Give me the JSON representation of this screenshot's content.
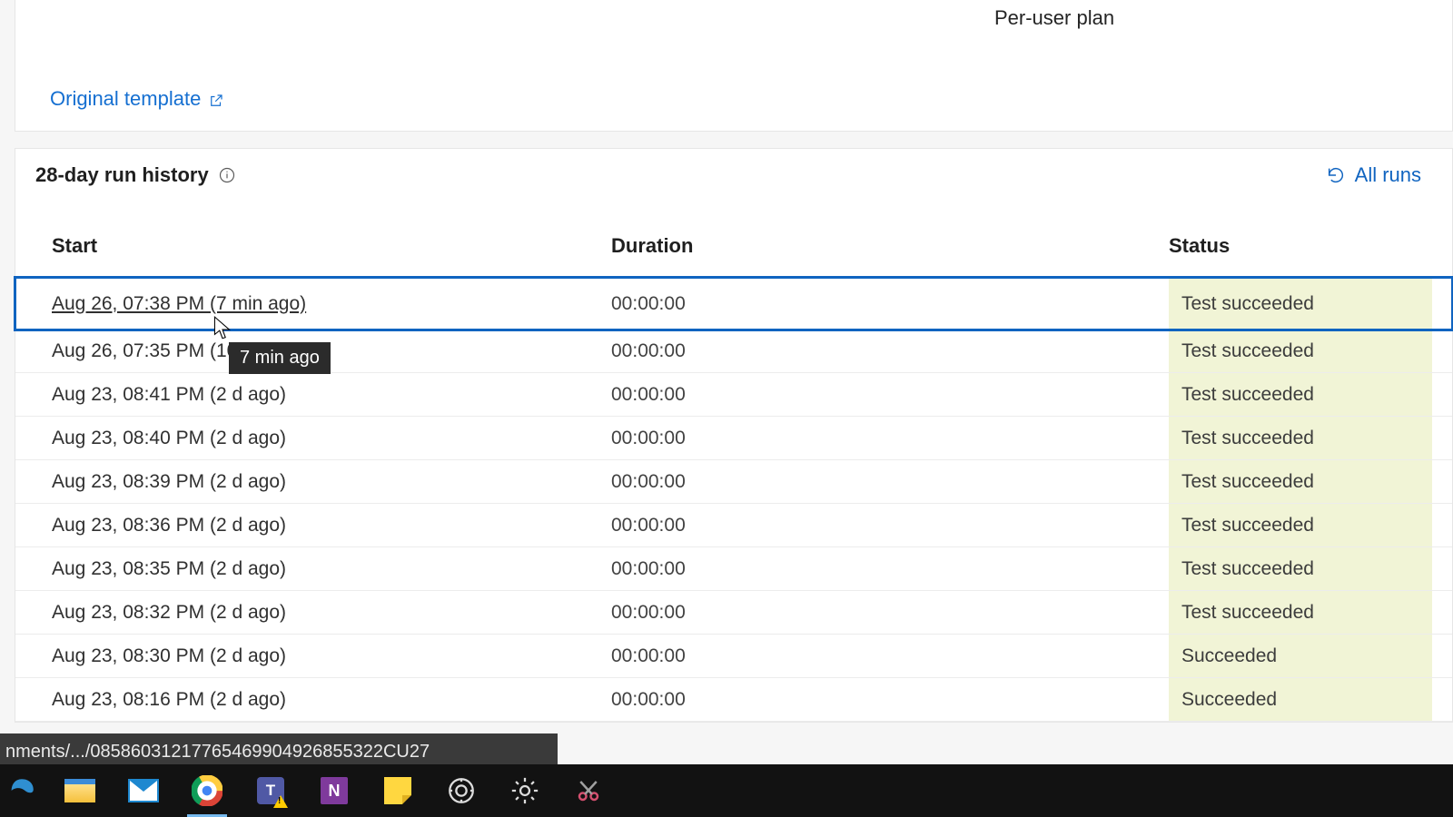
{
  "top": {
    "plan_label": "Per-user plan",
    "original_template_label": "Original template"
  },
  "history": {
    "title": "28-day run history",
    "all_runs_label": "All runs",
    "columns": {
      "start": "Start",
      "duration": "Duration",
      "status": "Status"
    },
    "rows": [
      {
        "start": "Aug 26, 07:38 PM (7 min ago)",
        "duration": "00:00:00",
        "status": "Test succeeded",
        "selected": true,
        "underline": true
      },
      {
        "start": "Aug 26, 07:35 PM (10",
        "duration": "00:00:00",
        "status": "Test succeeded"
      },
      {
        "start": "Aug 23, 08:41 PM (2 d ago)",
        "duration": "00:00:00",
        "status": "Test succeeded"
      },
      {
        "start": "Aug 23, 08:40 PM (2 d ago)",
        "duration": "00:00:00",
        "status": "Test succeeded"
      },
      {
        "start": "Aug 23, 08:39 PM (2 d ago)",
        "duration": "00:00:00",
        "status": "Test succeeded"
      },
      {
        "start": "Aug 23, 08:36 PM (2 d ago)",
        "duration": "00:00:00",
        "status": "Test succeeded"
      },
      {
        "start": "Aug 23, 08:35 PM (2 d ago)",
        "duration": "00:00:00",
        "status": "Test succeeded"
      },
      {
        "start": "Aug 23, 08:32 PM (2 d ago)",
        "duration": "00:00:00",
        "status": "Test succeeded"
      },
      {
        "start": "Aug 23, 08:30 PM (2 d ago)",
        "duration": "00:00:00",
        "status": "Succeeded"
      },
      {
        "start": "Aug 23, 08:16 PM (2 d ago)",
        "duration": "00:00:00",
        "status": "Succeeded"
      }
    ]
  },
  "tooltip": {
    "text": "7 min ago"
  },
  "url_status": "nments/.../08586031217765469904926855322CU27",
  "taskbar": {
    "items": [
      {
        "name": "edge"
      },
      {
        "name": "file-explorer"
      },
      {
        "name": "mail"
      },
      {
        "name": "chrome",
        "active": true
      },
      {
        "name": "teams"
      },
      {
        "name": "onenote"
      },
      {
        "name": "sticky-notes"
      },
      {
        "name": "obs"
      },
      {
        "name": "settings"
      },
      {
        "name": "snipping-tool"
      }
    ]
  }
}
